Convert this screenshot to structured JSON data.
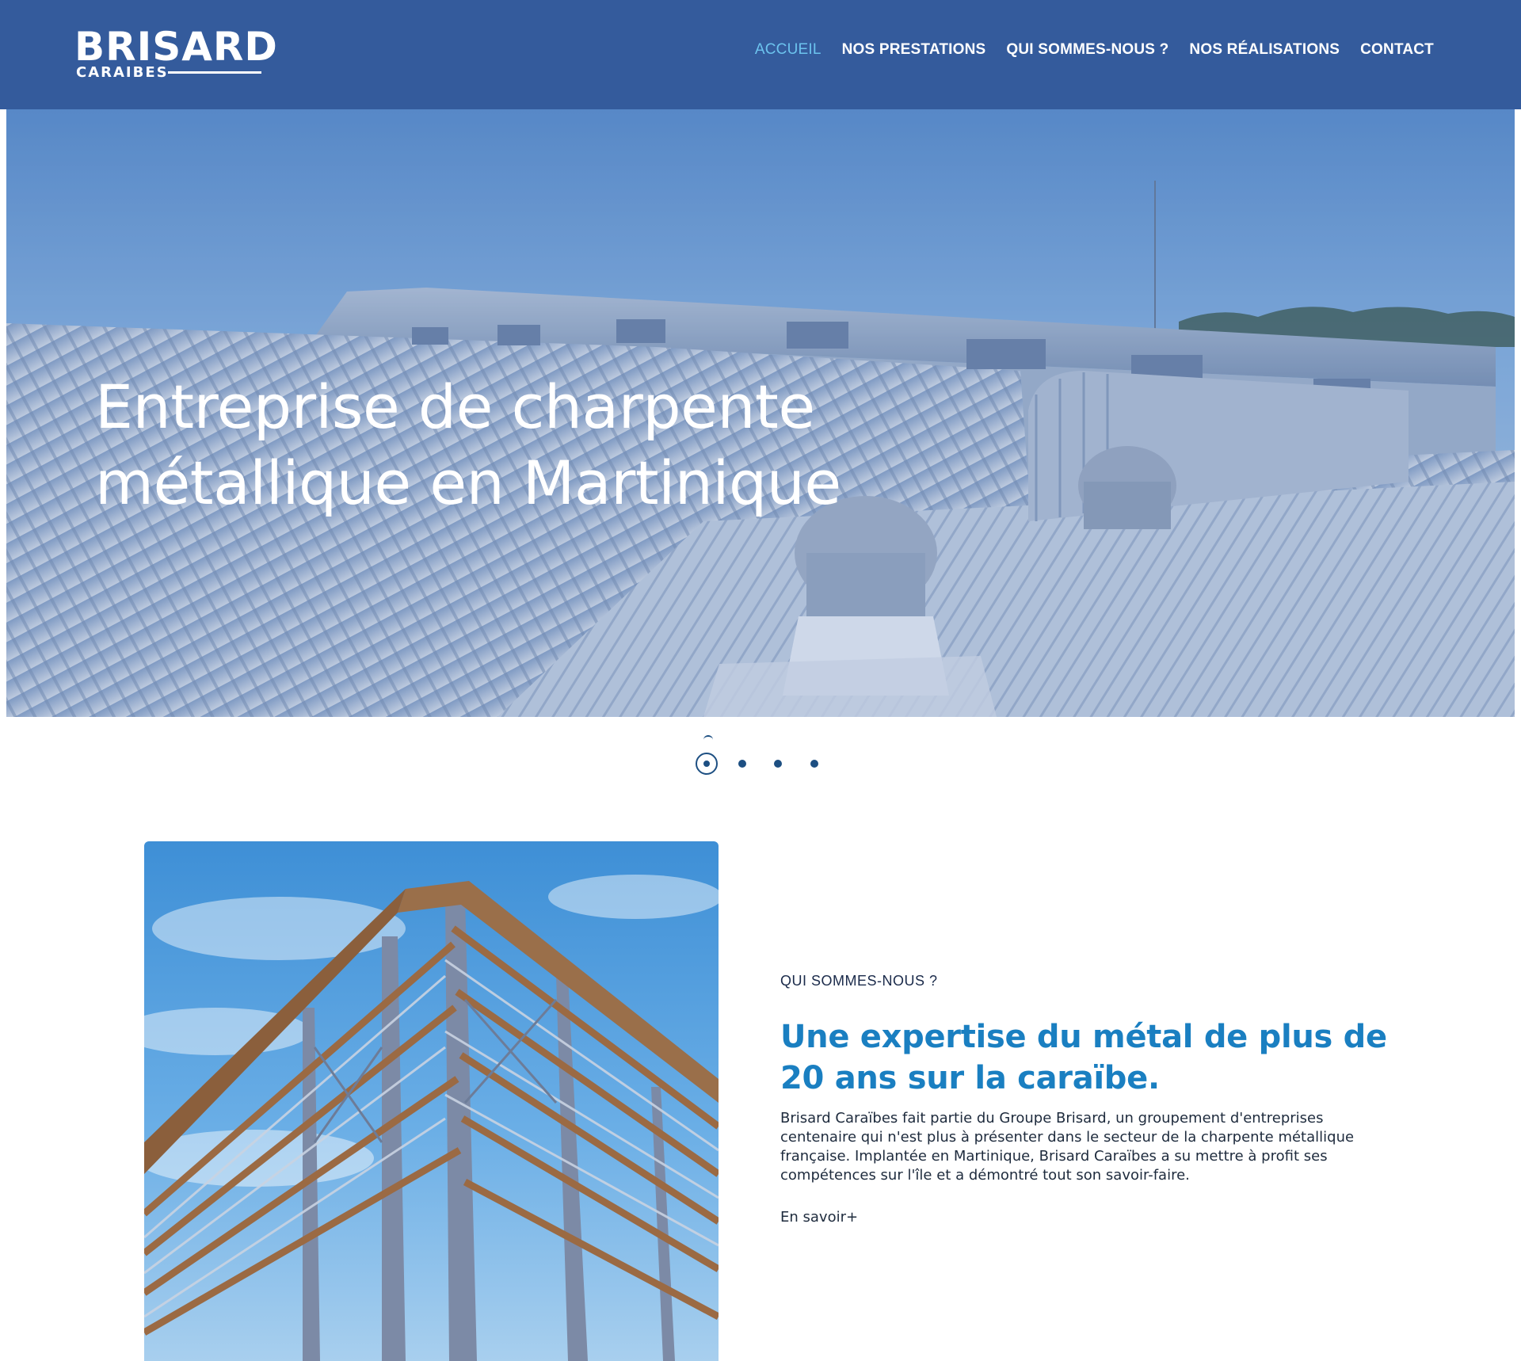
{
  "brand": {
    "name_top": "BRISARD",
    "name_bottom": "CARAIBES"
  },
  "nav": {
    "items": [
      {
        "label": "ACCUEIL",
        "active": true
      },
      {
        "label": "NOS PRESTATIONS",
        "active": false
      },
      {
        "label": "QUI SOMMES-NOUS ?",
        "active": false
      },
      {
        "label": "NOS RÉALISATIONS",
        "active": false
      },
      {
        "label": "CONTACT",
        "active": false
      }
    ]
  },
  "hero": {
    "title_line1": "Entreprise de charpente",
    "title_line2": "métallique en Martinique",
    "slides_total": 4,
    "active_slide": 1
  },
  "about": {
    "eyebrow": "QUI SOMMES-NOUS ?",
    "title": "Une expertise du métal de plus de 20 ans sur la caraïbe.",
    "text": "Brisard Caraïbes fait partie du Groupe Brisard, un groupement d'entreprises centenaire qui n'est plus à présenter dans le secteur de la charpente métallique française. Implantée en Martinique, Brisard Caraïbes a su mettre à profit ses compétences sur l'île et a démontré tout son savoir-faire.",
    "link": "En savoir+"
  },
  "colors": {
    "header_bg": "#345b9c",
    "nav_active": "#6cc3ee",
    "accent_title": "#1a7fc1",
    "dot": "#1d4f82"
  }
}
